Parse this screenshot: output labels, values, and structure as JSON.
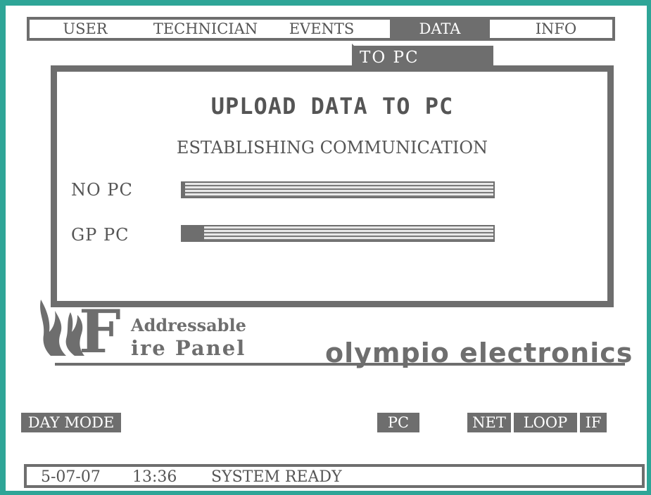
{
  "menu": {
    "items": [
      {
        "label": "USER",
        "active": false
      },
      {
        "label": "TECHNICIAN",
        "active": false
      },
      {
        "label": "EVENTS",
        "active": false
      },
      {
        "label": "DATA",
        "active": true
      },
      {
        "label": "INFO",
        "active": false
      }
    ],
    "submenu_label": "TO PC"
  },
  "dialog": {
    "title": "UPLOAD DATA TO PC",
    "status": "ESTABLISHING COMMUNICATION",
    "rows": [
      {
        "label": "NO PC",
        "progress": 0.01
      },
      {
        "label": "GP PC",
        "progress": 0.07
      }
    ]
  },
  "logo": {
    "letter": "F",
    "line1": "Addressable",
    "line2": "ire Panel",
    "brand": "olympio electronics"
  },
  "indicators": {
    "day_mode": "DAY MODE",
    "pc": "PC",
    "net": "NET",
    "loop": "LOOP",
    "if": "IF"
  },
  "statusbar": {
    "date": "5-07-07",
    "time": "13:36",
    "message": "SYSTEM READY"
  },
  "colors": {
    "frame": "#2ea597",
    "panel_gray": "#6e6e6e"
  }
}
